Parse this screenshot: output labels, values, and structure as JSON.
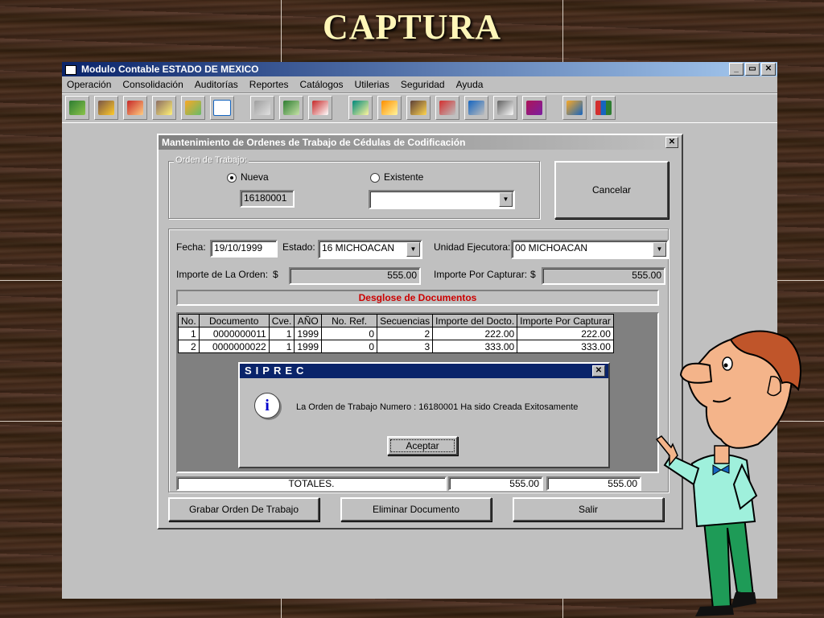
{
  "slide": {
    "title": "CAPTURA"
  },
  "app": {
    "title": "Modulo Contable ESTADO DE MEXICO",
    "window_buttons": [
      "_",
      "▭",
      "✕"
    ],
    "menu": [
      "Operación",
      "Consolidación",
      "Auditorías",
      "Reportes",
      "Catálogos",
      "Utilerias",
      "Seguridad",
      "Ayuda"
    ],
    "toolbar_icons": [
      "map-icon",
      "dispatch-icon",
      "cedulas-icon",
      "polizas-icon",
      "polizas-green-icon",
      "calendar-icon",
      "print-preview-icon",
      "search-report-icon",
      "clock-report-icon",
      "catalog-icon",
      "catalog-central-icon",
      "balance-icon",
      "printer-red-icon",
      "printer-blue-icon",
      "calculator-icon",
      "books-icon",
      "tools-icon",
      "help-chart-icon"
    ]
  },
  "dialog": {
    "title": "Mantenimiento de Ordenes de Trabajo de Cédulas de Codificación",
    "close_label": "✕",
    "group_label": "Orden de Trabajo:",
    "radio_new": "Nueva",
    "radio_existing": "Existente",
    "order_number": "16180001",
    "existing_value": "",
    "cancel_label": "Cancelar",
    "fecha_label": "Fecha:",
    "fecha_value": "19/10/1999",
    "estado_label": "Estado:",
    "estado_value": "16 MICHOACAN",
    "unidad_label": "Unidad Ejecutora:",
    "unidad_value": "00 MICHOACAN",
    "importe_orden_label": "Importe de La Orden:",
    "importe_por_capturar_label": "Importe Por Capturar:",
    "currency": "$",
    "importe_orden_value": "555.00",
    "importe_por_capturar_value": "555.00",
    "desglose_label": "Desglose de Documentos",
    "table": {
      "headers": [
        "No.",
        "Documento",
        "Cve.",
        "AÑO",
        "No. Ref.",
        "Secuencias",
        "Importe del Docto.",
        "Importe Por Capturar"
      ],
      "rows": [
        [
          "1",
          "0000000011",
          "1",
          "1999",
          "0",
          "2",
          "222.00",
          "222.00"
        ],
        [
          "2",
          "0000000022",
          "1",
          "1999",
          "0",
          "3",
          "333.00",
          "333.00"
        ]
      ]
    },
    "totales_label": "TOTALES.",
    "total_docto": "555.00",
    "total_por_capturar": "555.00",
    "btn_grabar": "Grabar Orden De Trabajo",
    "btn_eliminar": "Eliminar Documento",
    "btn_salir": "Salir"
  },
  "msgbox": {
    "title": "SIPREC",
    "close_label": "✕",
    "message": "La Orden de Trabajo Numero : 16180001 Ha sido Creada Exitosamente",
    "ok_label": "Aceptar"
  }
}
